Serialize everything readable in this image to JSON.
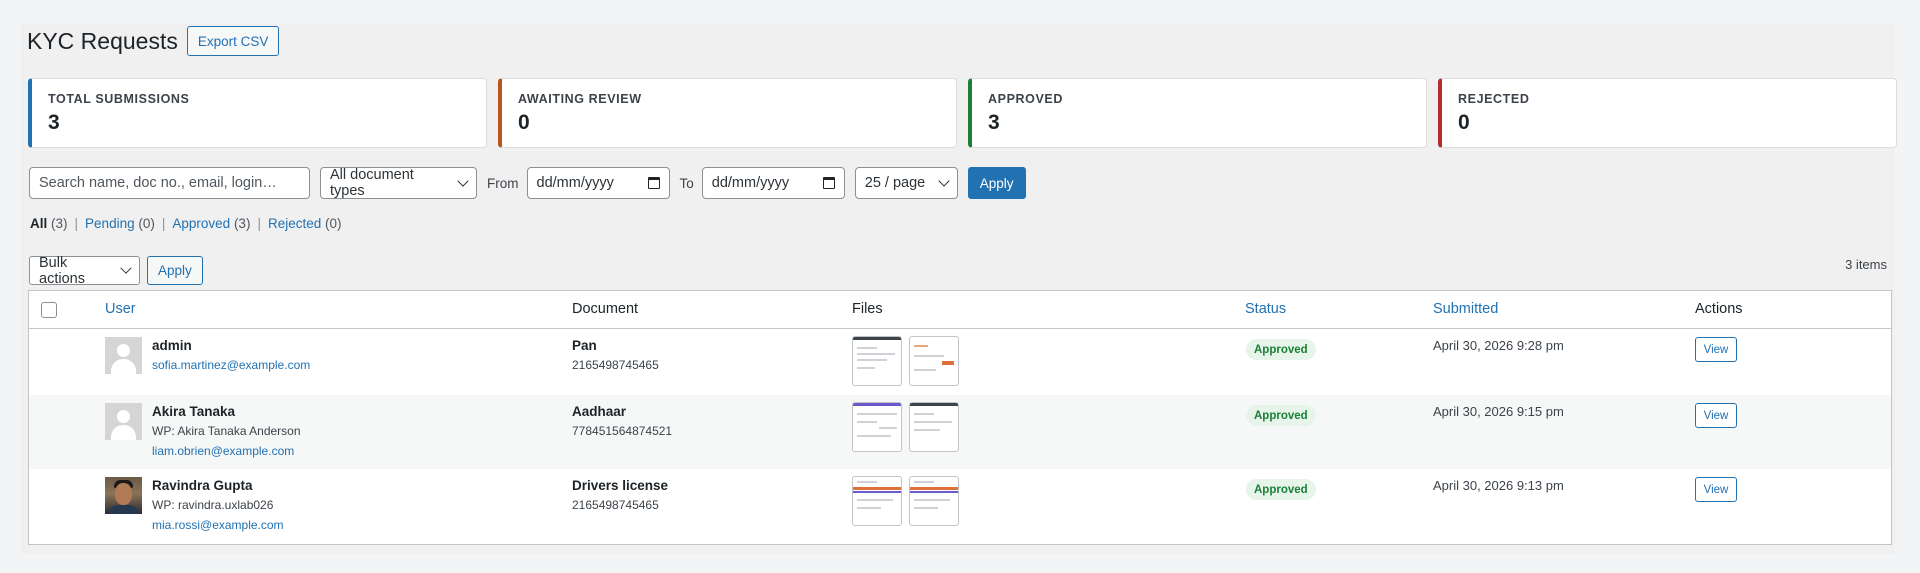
{
  "header": {
    "title": "KYC Requests",
    "export_label": "Export CSV"
  },
  "stats": [
    {
      "label": "TOTAL SUBMISSIONS",
      "value": "3",
      "color": "#2271b1"
    },
    {
      "label": "AWAITING REVIEW",
      "value": "0",
      "color": "#b9561c"
    },
    {
      "label": "APPROVED",
      "value": "3",
      "color": "#1a7f37"
    },
    {
      "label": "REJECTED",
      "value": "0",
      "color": "#b32d2e"
    }
  ],
  "filters": {
    "search_placeholder": "Search name, doc no., email, login…",
    "doc_type": "All document types",
    "from_label": "From",
    "from_value": "dd/mm/yyyy",
    "to_label": "To",
    "to_value": "dd/mm/yyyy",
    "per_page": "25 / page",
    "apply_label": "Apply"
  },
  "views": {
    "all": {
      "label": "All",
      "count": "(3)"
    },
    "pending": {
      "label": "Pending",
      "count": "(0)"
    },
    "approved": {
      "label": "Approved",
      "count": "(3)"
    },
    "rejected": {
      "label": "Rejected",
      "count": "(0)"
    },
    "sep": "|"
  },
  "bulk": {
    "label": "Bulk actions",
    "apply_label": "Apply",
    "items_count": "3 items"
  },
  "table": {
    "columns": {
      "user": "User",
      "document": "Document",
      "files": "Files",
      "status": "Status",
      "submitted": "Submitted",
      "actions": "Actions"
    },
    "rows": [
      {
        "name": "admin",
        "wp": "",
        "email": "sofia.martinez@example.com",
        "doc_type": "Pan",
        "doc_no": "2165498745465",
        "status": "Approved",
        "submitted": "April 30, 2026 9:28 pm",
        "action": "View"
      },
      {
        "name": "Akira Tanaka",
        "wp": "WP: Akira Tanaka Anderson",
        "email": "liam.obrien@example.com",
        "doc_type": "Aadhaar",
        "doc_no": "778451564874521",
        "status": "Approved",
        "submitted": "April 30, 2026 9:15 pm",
        "action": "View"
      },
      {
        "name": "Ravindra Gupta",
        "wp": "WP: ravindra.uxlab026",
        "email": "mia.rossi@example.com",
        "doc_type": "Drivers license",
        "doc_no": "2165498745465",
        "status": "Approved",
        "submitted": "April 30, 2026 9:13 pm",
        "action": "View"
      }
    ]
  }
}
